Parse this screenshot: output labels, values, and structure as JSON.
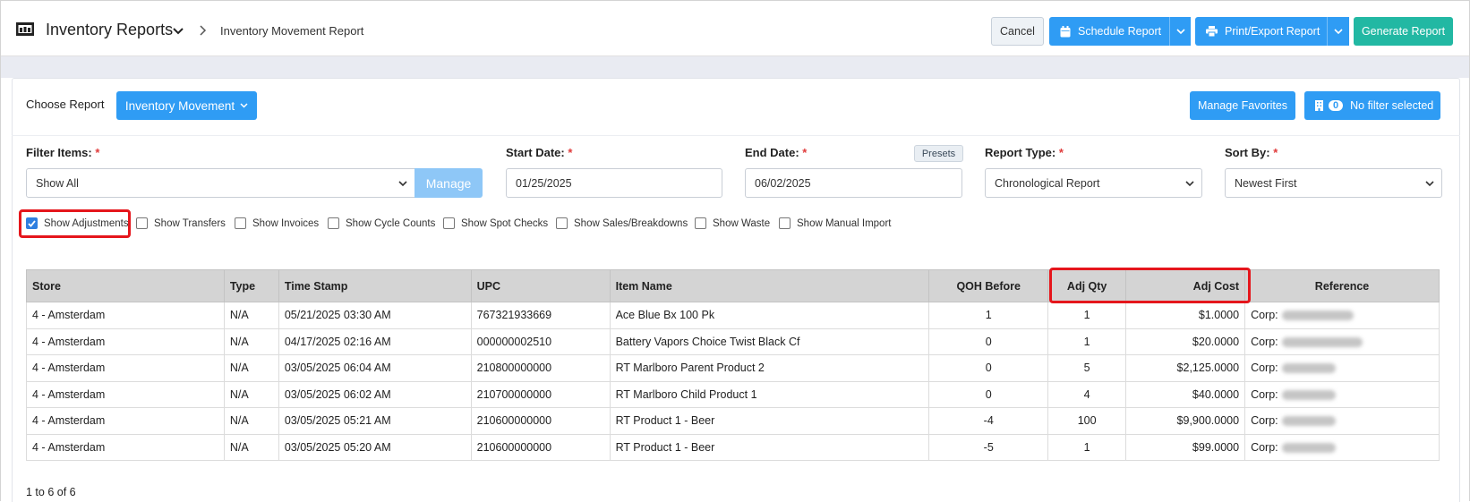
{
  "header": {
    "app_title": "Inventory Reports",
    "breadcrumb_current": "Inventory Movement Report",
    "cancel_label": "Cancel",
    "schedule_label": "Schedule Report",
    "print_label": "Print/Export Report",
    "generate_label": "Generate Report"
  },
  "toolbar": {
    "choose_report_label": "Choose Report",
    "report_selected": "Inventory Movement",
    "manage_favorites_label": "Manage Favorites",
    "filter_count": "0",
    "filter_status": "No filter selected"
  },
  "filters": {
    "filter_items_label": "Filter Items:",
    "filter_items_value": "Show All",
    "manage_label": "Manage",
    "start_date_label": "Start Date:",
    "start_date_value": "01/25/2025",
    "end_date_label": "End Date:",
    "end_date_value": "06/02/2025",
    "presets_label": "Presets",
    "report_type_label": "Report Type:",
    "report_type_value": "Chronological Report",
    "sort_by_label": "Sort By:",
    "sort_by_value": "Newest First",
    "required_marker": "*"
  },
  "checkboxes": [
    {
      "label": "Show Adjustments",
      "checked": true
    },
    {
      "label": "Show Transfers",
      "checked": false
    },
    {
      "label": "Show Invoices",
      "checked": false
    },
    {
      "label": "Show Cycle Counts",
      "checked": false
    },
    {
      "label": "Show Spot Checks",
      "checked": false
    },
    {
      "label": "Show Sales/Breakdowns",
      "checked": false
    },
    {
      "label": "Show Waste",
      "checked": false
    },
    {
      "label": "Show Manual Import",
      "checked": false
    }
  ],
  "table": {
    "headers": [
      "Store",
      "Type",
      "Time Stamp",
      "UPC",
      "Item Name",
      "QOH Before",
      "Adj Qty",
      "Adj Cost",
      "Reference"
    ],
    "reference_prefix": "Corp:",
    "rows": [
      {
        "store": "4 - Amsterdam",
        "type": "N/A",
        "time": "05/21/2025 03:30 AM",
        "upc": "767321933669",
        "item": "Ace Blue Bx 100 Pk",
        "qoh": "1",
        "qty": "1",
        "cost": "$1.0000"
      },
      {
        "store": "4 - Amsterdam",
        "type": "N/A",
        "time": "04/17/2025 02:16 AM",
        "upc": "000000002510",
        "item": "Battery Vapors Choice Twist Black Cf",
        "qoh": "0",
        "qty": "1",
        "cost": "$20.0000"
      },
      {
        "store": "4 - Amsterdam",
        "type": "N/A",
        "time": "03/05/2025 06:04 AM",
        "upc": "210800000000",
        "item": "RT Marlboro Parent Product 2",
        "qoh": "0",
        "qty": "5",
        "cost": "$2,125.0000"
      },
      {
        "store": "4 - Amsterdam",
        "type": "N/A",
        "time": "03/05/2025 06:02 AM",
        "upc": "210700000000",
        "item": "RT Marlboro Child Product 1",
        "qoh": "0",
        "qty": "4",
        "cost": "$40.0000"
      },
      {
        "store": "4 - Amsterdam",
        "type": "N/A",
        "time": "03/05/2025 05:21 AM",
        "upc": "210600000000",
        "item": "RT Product 1 - Beer",
        "qoh": "-4",
        "qty": "100",
        "cost": "$9,900.0000"
      },
      {
        "store": "4 - Amsterdam",
        "type": "N/A",
        "time": "03/05/2025 05:20 AM",
        "upc": "210600000000",
        "item": "RT Product 1 - Beer",
        "qoh": "-5",
        "qty": "1",
        "cost": "$99.0000"
      }
    ]
  },
  "pagination": {
    "summary": "1 to 6 of 6"
  },
  "colors": {
    "primary": "#2f9cf4",
    "teal": "#22b8a3",
    "highlight": "#e5161c"
  }
}
